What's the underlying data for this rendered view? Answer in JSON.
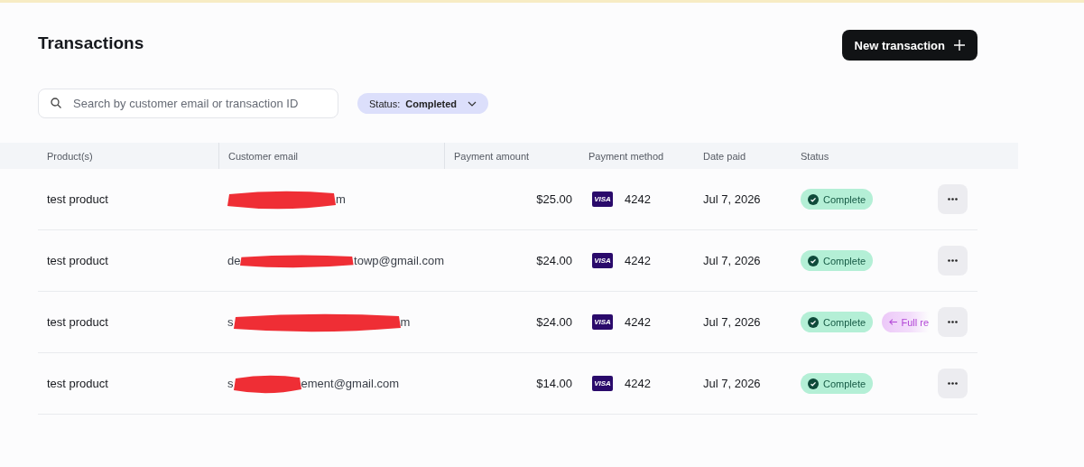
{
  "title": "Transactions",
  "new_button": {
    "label": "New transaction"
  },
  "search": {
    "placeholder": "Search by customer email or transaction ID"
  },
  "filter": {
    "label": "Status:",
    "value": "Completed"
  },
  "table": {
    "columns": [
      "Product(s)",
      "Customer email",
      "Payment amount",
      "Payment method",
      "Date paid",
      "Status"
    ],
    "rows": [
      {
        "product": "test product",
        "email_start": "",
        "email_end": "m",
        "amount": "$25.00",
        "card_brand": "VISA",
        "card_last4": "4242",
        "date": "Jul 7, 2026",
        "status": "Complete",
        "refund": ""
      },
      {
        "product": "test product",
        "email_start": "de",
        "email_end": "towp@gmail.com",
        "amount": "$24.00",
        "card_brand": "VISA",
        "card_last4": "4242",
        "date": "Jul 7, 2026",
        "status": "Complete",
        "refund": ""
      },
      {
        "product": "test product",
        "email_start": "s",
        "email_end": "m",
        "amount": "$24.00",
        "card_brand": "VISA",
        "card_last4": "4242",
        "date": "Jul 7, 2026",
        "status": "Complete",
        "refund": "Full re"
      },
      {
        "product": "test product",
        "email_start": "s",
        "email_end": "ement@gmail.com",
        "amount": "$14.00",
        "card_brand": "VISA",
        "card_last4": "4242",
        "date": "Jul 7, 2026",
        "status": "Complete",
        "refund": ""
      }
    ]
  }
}
